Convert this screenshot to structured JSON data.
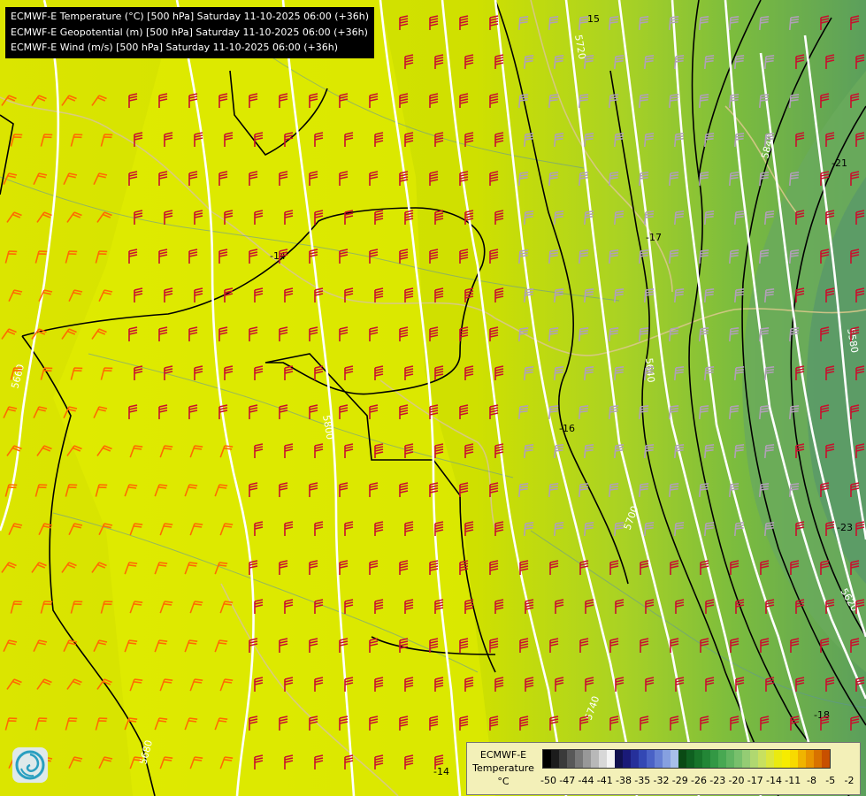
{
  "header": {
    "line1": "ECMWF-E Temperature (°C) [500 hPa] Saturday 11-10-2025 06:00 (+36h)",
    "line2": "ECMWF-E Geopotential (m) [500 hPa] Saturday 11-10-2025 06:00 (+36h)",
    "line3": "ECMWF-E Wind (m/s) [500 hPa] Saturday 11-10-2025 06:00 (+36h)"
  },
  "legend": {
    "title_line1": "ECMWF-E",
    "title_line2": "Temperature",
    "unit": "°C",
    "ticks": [
      "-50",
      "-47",
      "-44",
      "-41",
      "-38",
      "-35",
      "-32",
      "-29",
      "-26",
      "-23",
      "-20",
      "-17",
      "-14",
      "-11",
      "-8",
      "-5",
      "-2"
    ],
    "colors": [
      "#000000",
      "#1c1c1c",
      "#3a3a3a",
      "#585858",
      "#787878",
      "#989898",
      "#b8b8b8",
      "#d8d8d8",
      "#f4f4f4",
      "#11114f",
      "#1a1a78",
      "#26309a",
      "#3348b4",
      "#4a62c6",
      "#6680d4",
      "#86a0e0",
      "#a8c0ea",
      "#0a4a14",
      "#0f6020",
      "#18742a",
      "#238636",
      "#339844",
      "#48a852",
      "#60b460",
      "#78c06c",
      "#94cc74",
      "#b0d870",
      "#c8e060",
      "#dce63c",
      "#eaea10",
      "#f6ec00",
      "#f8da00",
      "#f0b400",
      "#e89400",
      "#d87200",
      "#c85000",
      "#b83000",
      "#a81800",
      "#8c1890",
      "#a030b8",
      "#7a10b0",
      "#5a0a8c",
      "#3c0670"
    ]
  },
  "map": {
    "background_colors": [
      "#dbe500",
      "#9fce2a",
      "#64a86a"
    ],
    "isotherm_labels": [
      "-14",
      "-15",
      "-16",
      "-17",
      "-18",
      "-21",
      "-23",
      "-14"
    ],
    "isohypse_labels": [
      "5720",
      "5800",
      "5840",
      "5640",
      "5660",
      "5700",
      "5740",
      "5620",
      "5680",
      "5580"
    ],
    "wind_barb_colors": [
      "#c8102e",
      "#ff6a00",
      "#b0a0b8"
    ]
  }
}
